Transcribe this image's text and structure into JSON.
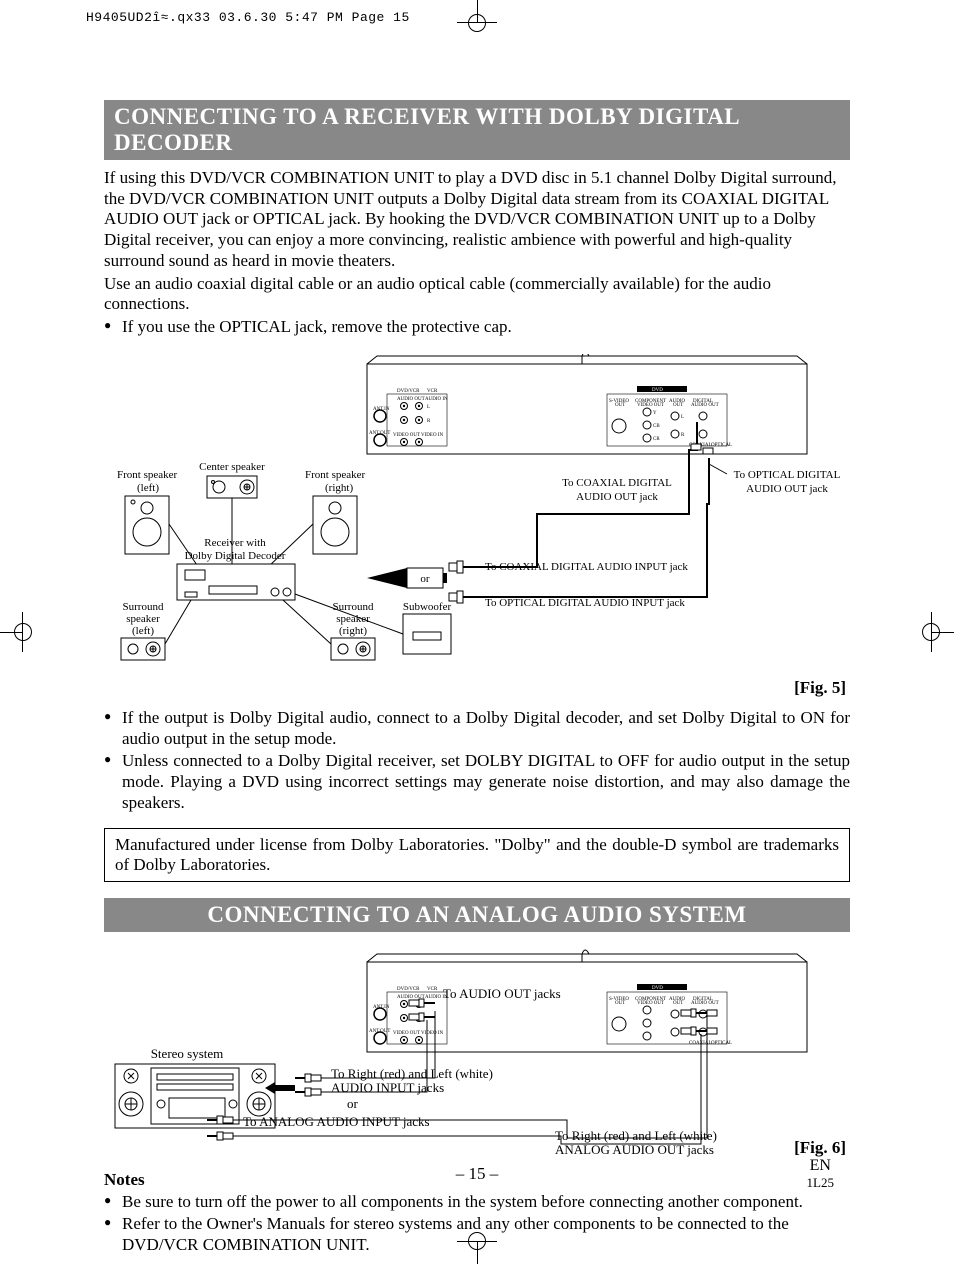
{
  "header": {
    "job_line": "H9405UD2î≈.qx33   03.6.30 5:47 PM   Page 15"
  },
  "section1": {
    "title": "CONNECTING TO A RECEIVER WITH DOLBY DIGITAL DECODER",
    "intro_para": "If using this DVD/VCR COMBINATION UNIT to play a DVD disc in 5.1 channel Dolby Digital surround, the DVD/VCR COMBINATION UNIT outputs a Dolby Digital data stream from its COAXIAL DIGITAL AUDIO OUT jack or OPTICAL jack. By hooking the DVD/VCR COMBINATION UNIT up to a Dolby Digital receiver, you can enjoy a more convincing, realistic ambience with powerful and high-quality surround sound as heard in movie theaters.",
    "second_para": "Use an audio coaxial digital cable or an audio optical cable (commercially available) for the audio connections.",
    "bullet_top": "If you use the OPTICAL jack, remove the protective cap.",
    "fig_label": "[Fig. 5]",
    "diagram_labels": {
      "front_left": "Front speaker\n(left)",
      "center": "Center speaker",
      "front_right": "Front speaker\n(right)",
      "receiver": "Receiver with\nDolby Digital Decoder",
      "surround_left": "Surround\nspeaker\n(left)",
      "surround_right": "Surround\nspeaker\n(right)",
      "subwoofer": "Subwoofer",
      "or": "or",
      "to_coax_out": "To COAXIAL DIGITAL\nAUDIO OUT jack",
      "to_optical_out": "To OPTICAL DIGITAL\nAUDIO OUT  jack",
      "to_coax_in": "To COAXIAL DIGITAL AUDIO INPUT jack",
      "to_optical_in": "To OPTICAL DIGITAL AUDIO INPUT jack",
      "panel_dvdvcr": "DVD/VCR",
      "panel_vcr": "VCR",
      "panel_audio_out": "AUDIO OUT",
      "panel_audio_in": "AUDIO IN",
      "panel_antin": "ANT.IN",
      "panel_antout": "ANT.OUT",
      "panel_video_out": "VIDEO OUT",
      "panel_video_in": "VIDEO IN",
      "panel_dvd": "DVD",
      "panel_svideo": "S-VIDEO\nOUT",
      "panel_component": "COMPONENT\nVIDEO OUT",
      "panel_audio": "AUDIO\nOUT",
      "panel_digital": "DIGITAL\nAUDIO OUT",
      "panel_coaxial": "COAXIAL",
      "panel_optical": "OPTICAL",
      "panel_y": "Y",
      "panel_cb": "CB",
      "panel_cr": "CR",
      "panel_l": "L",
      "panel_r": "R"
    },
    "bullets_after": [
      "If the output is Dolby Digital audio, connect to a Dolby Digital decoder, and set Dolby Digital to ON for audio output in the setup mode.",
      "Unless connected to a Dolby Digital receiver, set DOLBY DIGITAL to OFF for audio output in the setup mode. Playing a DVD using incorrect settings may generate noise distortion, and may also damage the speakers."
    ],
    "license_box": "Manufactured under license from Dolby Laboratories. \"Dolby\" and the double-D symbol are trademarks of Dolby Laboratories."
  },
  "section2": {
    "title": "CONNECTING TO AN ANALOG AUDIO SYSTEM",
    "fig_label": "[Fig. 6]",
    "diagram_labels": {
      "stereo": "Stereo system",
      "to_audio_out": "To AUDIO OUT jacks",
      "to_rl_input": "To Right (red) and Left (white)\nAUDIO INPUT jacks",
      "or": "or",
      "to_analog_input": "To ANALOG AUDIO INPUT jacks",
      "to_rl_analog_out": "To Right (red) and Left (white)\nANALOG AUDIO OUT jacks"
    },
    "notes_title": "Notes",
    "notes": [
      "Be sure to turn off the power to all components in the system before connecting another component.",
      "Refer to the Owner's Manuals for stereo systems and any other components to be connected to the DVD/VCR COMBINATION UNIT."
    ]
  },
  "footer": {
    "page_num": "– 15 –",
    "lang": "EN",
    "code": "1L25"
  }
}
